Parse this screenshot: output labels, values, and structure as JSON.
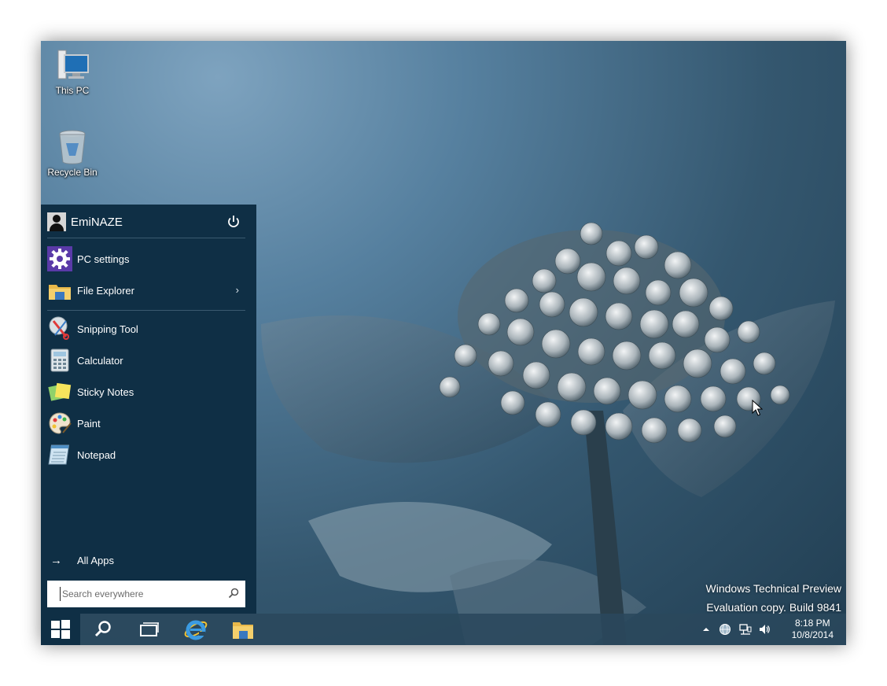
{
  "desktop": {
    "icons": [
      {
        "label": "This PC",
        "icon": "computer-icon"
      },
      {
        "label": "Recycle Bin",
        "icon": "recycle-bin-icon"
      }
    ],
    "watermark": {
      "line1": "Windows Technical Preview",
      "line2": "Evaluation copy. Build 9841"
    }
  },
  "start_menu": {
    "user_name": "EmiNAZE",
    "power_icon": "power-icon",
    "pinned": [
      {
        "label": "PC settings",
        "icon": "gear-icon"
      },
      {
        "label": "File Explorer",
        "icon": "folder-icon",
        "has_submenu": true
      }
    ],
    "apps": [
      {
        "label": "Snipping Tool",
        "icon": "scissors-icon"
      },
      {
        "label": "Calculator",
        "icon": "calculator-icon"
      },
      {
        "label": "Sticky Notes",
        "icon": "sticky-notes-icon"
      },
      {
        "label": "Paint",
        "icon": "palette-icon"
      },
      {
        "label": "Notepad",
        "icon": "notepad-icon"
      }
    ],
    "all_apps_label": "All Apps",
    "search": {
      "placeholder": "Search everywhere",
      "value": ""
    }
  },
  "taskbar": {
    "buttons": [
      "windows-logo-icon",
      "search-icon",
      "task-view-icon",
      "internet-explorer-icon",
      "file-explorer-icon"
    ],
    "tray": {
      "icons": [
        "chevron-up-icon",
        "network-globe-icon",
        "network-icon",
        "volume-icon"
      ],
      "time": "8:18 PM",
      "date": "10/8/2014"
    }
  },
  "colors": {
    "start_menu_bg": "#0f2f45",
    "taskbar_bg": "#2a485c",
    "text": "#ffffff"
  }
}
